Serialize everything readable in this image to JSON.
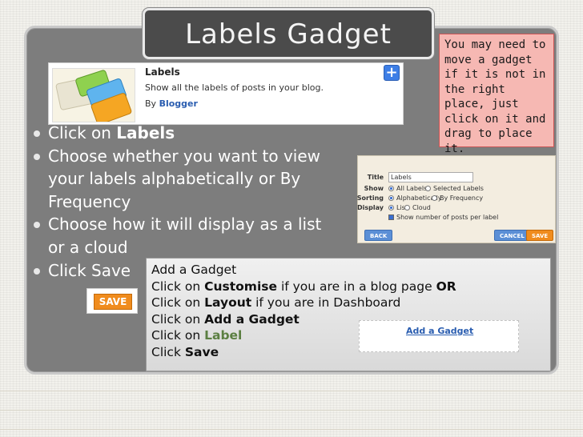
{
  "slide": {
    "title": "Labels Gadget",
    "note": "You may need to move a gadget if it is not in the  right place, just click on it and drag to place it."
  },
  "gadget_card": {
    "title": "Labels",
    "description": "Show all the labels of posts in your blog.",
    "by_prefix": "By",
    "by_author": "Blogger",
    "add_icon": "plus-icon"
  },
  "bullets": [
    {
      "prefix": "Click on ",
      "bold": "Labels",
      "suffix": ""
    },
    {
      "prefix": "Choose whether you want to view your labels alphabetically or By Frequency",
      "bold": "",
      "suffix": ""
    },
    {
      "prefix": "Choose how it will display as a list or a cloud",
      "bold": "",
      "suffix": ""
    },
    {
      "prefix": "Click Save",
      "bold": "",
      "suffix": ""
    }
  ],
  "config_form": {
    "title_label": "Title",
    "title_value": "Labels",
    "show_label": "Show",
    "show_options": [
      "All Labels",
      "Selected Labels"
    ],
    "sorting_label": "Sorting",
    "sorting_options": [
      "Alphabetically",
      "By Frequency"
    ],
    "display_label": "Display",
    "display_options": [
      "List",
      "Cloud"
    ],
    "show_count_label": "Show number of posts per label",
    "back_button": "BACK",
    "cancel_button": "CANCEL",
    "save_button": "SAVE"
  },
  "save_example": {
    "label": "SAVE"
  },
  "steps": {
    "line1": "Add a Gadget",
    "line2_a": "Click on ",
    "line2_b": "Customise",
    "line2_c": " if you are in a blog page ",
    "line2_d": "OR",
    "line3_a": "Click on ",
    "line3_b": "Layout",
    "line3_c": " if you are in Dashboard",
    "line4_a": "Click on ",
    "line4_b": "Add a Gadget",
    "line5_a": "Click on ",
    "line5_b": "Label",
    "line6_a": "Click ",
    "line6_b": "Save"
  },
  "add_gadget_link": {
    "label": "Add a Gadget"
  },
  "colors": {
    "panel": "#7d7d7d",
    "title_bg": "#4b4b4b",
    "note_bg": "#f6b8b3",
    "save_orange": "#f08c1e",
    "link_blue": "#2a5db0"
  }
}
